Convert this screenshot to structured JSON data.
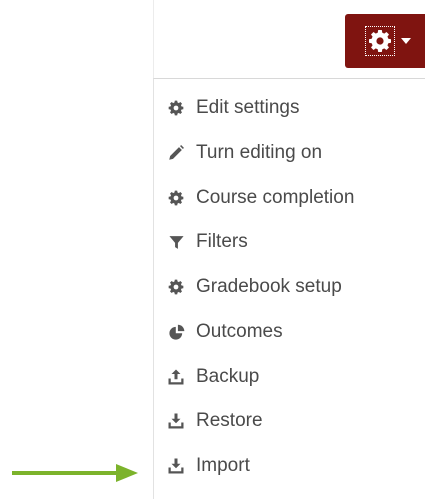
{
  "colors": {
    "toggle_bg": "#7f1410",
    "menu_text": "#4a4a4a",
    "icon": "#555555",
    "arrow": "#7cb32b"
  },
  "menu": {
    "toggle_icon": "gear-icon",
    "items": [
      {
        "label": "Edit settings",
        "icon": "gear-icon"
      },
      {
        "label": "Turn editing on",
        "icon": "pencil-icon"
      },
      {
        "label": "Course completion",
        "icon": "gear-icon"
      },
      {
        "label": "Filters",
        "icon": "filter-icon"
      },
      {
        "label": "Gradebook setup",
        "icon": "gear-icon"
      },
      {
        "label": "Outcomes",
        "icon": "pie-chart-icon"
      },
      {
        "label": "Backup",
        "icon": "upload-icon"
      },
      {
        "label": "Restore",
        "icon": "download-icon"
      },
      {
        "label": "Import",
        "icon": "download-icon"
      }
    ]
  },
  "annotation": {
    "arrow_target": "Import",
    "arrow_icon": "arrow-right-icon"
  }
}
